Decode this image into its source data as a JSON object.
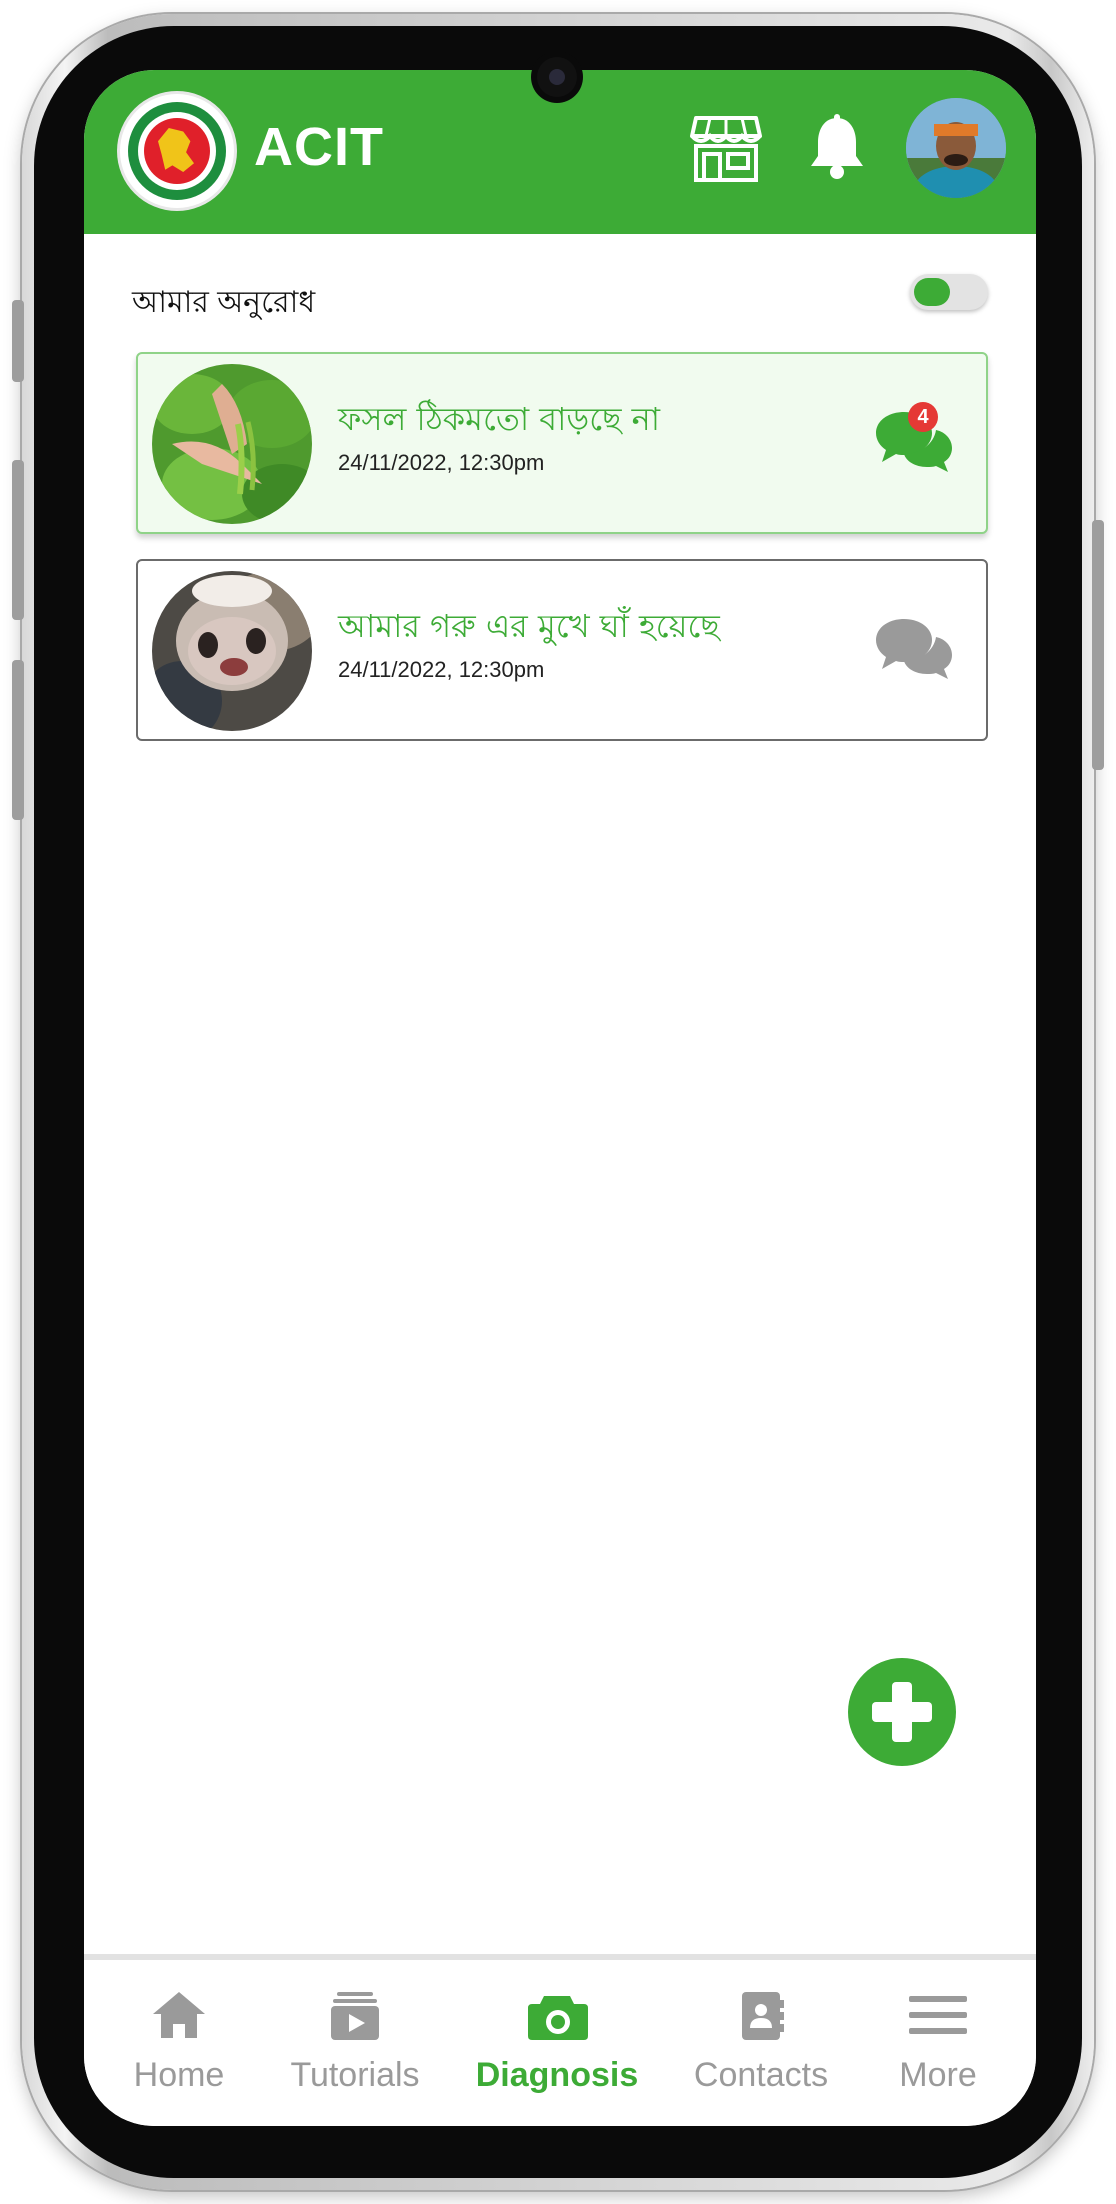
{
  "header": {
    "title": "ACIT",
    "icons": [
      "store-icon",
      "bell-icon",
      "avatar"
    ]
  },
  "filter": {
    "label": "আমার অনুরোধ",
    "toggle_on": true
  },
  "requests": [
    {
      "title": "ফসল ঠিকমতো বাড়ছে না",
      "date": "24/11/2022, 12:30pm",
      "unread": "4",
      "image": "plant-leaves-photo"
    },
    {
      "title": "আমার গরু এর মুখে ঘাঁ হয়েছে",
      "date": "24/11/2022, 12:30pm",
      "image": "cow-nose-photo"
    }
  ],
  "fab": {
    "icon": "plus-icon"
  },
  "nav": {
    "items": [
      {
        "label": "Home",
        "icon": "home-icon"
      },
      {
        "label": "Tutorials",
        "icon": "video-library-icon"
      },
      {
        "label": "Diagnosis",
        "icon": "camera-icon"
      },
      {
        "label": "Contacts",
        "icon": "contact-book-icon"
      },
      {
        "label": "More",
        "icon": "menu-icon"
      }
    ],
    "active": "Diagnosis"
  },
  "colors": {
    "primary": "#3dab36",
    "badge": "#e53935",
    "inactive": "#9a9a9a"
  }
}
